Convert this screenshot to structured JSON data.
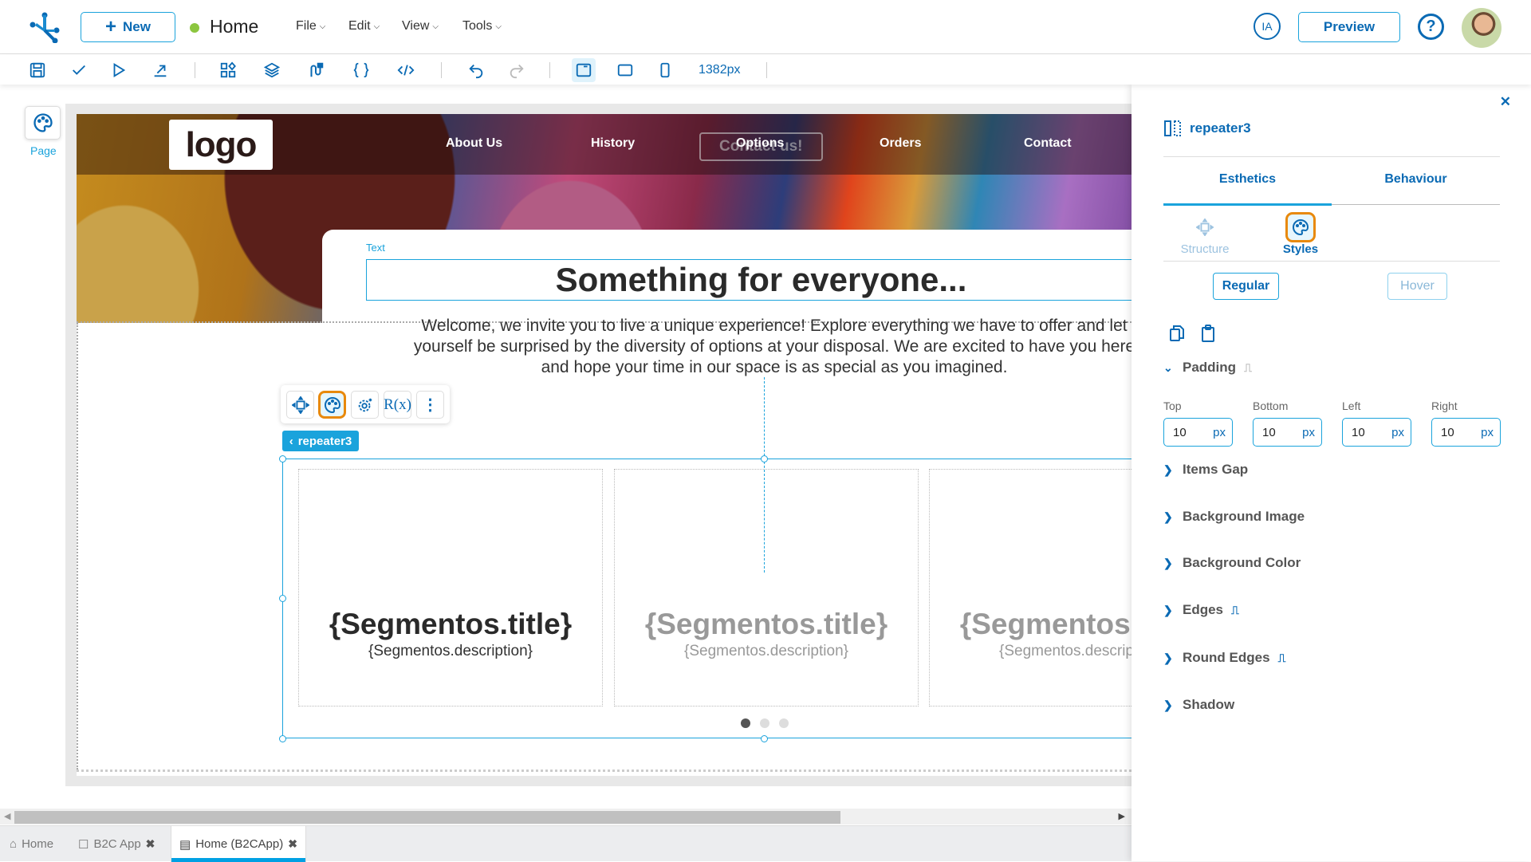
{
  "topbar": {
    "new_label": "New",
    "page_name": "Home",
    "page_status_color": "#8cc63f",
    "menus": [
      "File",
      "Edit",
      "View",
      "Tools"
    ],
    "ia_label": "IA",
    "preview_label": "Preview",
    "help_label": "?"
  },
  "toolbar": {
    "icons": [
      "save-icon",
      "check-icon",
      "play-icon",
      "export-icon",
      "components-icon",
      "layers-icon",
      "flow-icon",
      "braces-icon",
      "code-icon",
      "undo-icon",
      "redo-icon",
      "desktop-view-icon",
      "tablet-view-icon",
      "mobile-view-icon"
    ],
    "width_readout": "1382px"
  },
  "left": {
    "page_label": "Page"
  },
  "canvas": {
    "logo_text": "logo",
    "nav_links": [
      "About Us",
      "History",
      "Options",
      "Orders",
      "Contact"
    ],
    "contact_button_ghost": "Contact us!",
    "text_tag": "Text",
    "title": "Something for everyone...",
    "welcome_line1": "Welcome, we invite you to live a unique experience! Explore everything we have to offer and let",
    "welcome_line2": "yourself be surprised by the diversity of options at your disposal. We are excited to have you here",
    "welcome_line3": "and hope your time in our space is as special as you imagined.",
    "selected_badge": "repeater3",
    "float_toolbar": [
      "move-icon",
      "palette-icon",
      "settings-icon",
      "rx-icon",
      "more-icon"
    ],
    "rx_label": "R(x)",
    "repeater_items": [
      {
        "title": "{Segmentos.title}",
        "description": "{Segmentos.description}"
      },
      {
        "title": "{Segmentos.title}",
        "description": "{Segmentos.description}"
      },
      {
        "title": "{Segmentos.title}",
        "description": "{Segmentos.description}"
      }
    ],
    "pager": {
      "pages": 3,
      "active": 1
    }
  },
  "tabs": [
    {
      "label": "Home",
      "icon": "home-icon",
      "closable": false
    },
    {
      "label": "B2C App",
      "icon": "folder-icon",
      "closable": true
    },
    {
      "label": "Home (B2CApp)",
      "icon": "page-icon",
      "closable": true,
      "active": true
    }
  ],
  "panel": {
    "component_name": "repeater3",
    "tabs": [
      "Esthetics",
      "Behaviour"
    ],
    "active_tab": "Esthetics",
    "subtabs": [
      "Structure",
      "Styles"
    ],
    "active_subtab": "Styles",
    "states": [
      "Regular",
      "Hover"
    ],
    "active_state": "Regular",
    "padding": {
      "title": "Padding",
      "fields": [
        {
          "label": "Top",
          "value": "10",
          "unit": "px"
        },
        {
          "label": "Bottom",
          "value": "10",
          "unit": "px"
        },
        {
          "label": "Left",
          "value": "10",
          "unit": "px"
        },
        {
          "label": "Right",
          "value": "10",
          "unit": "px"
        }
      ]
    },
    "sections": [
      "Items Gap",
      "Background Image",
      "Background Color",
      "Edges",
      "Round Edges",
      "Shadow"
    ],
    "accent_color": "#0a6ab4",
    "highlight_color": "#e8890c"
  }
}
